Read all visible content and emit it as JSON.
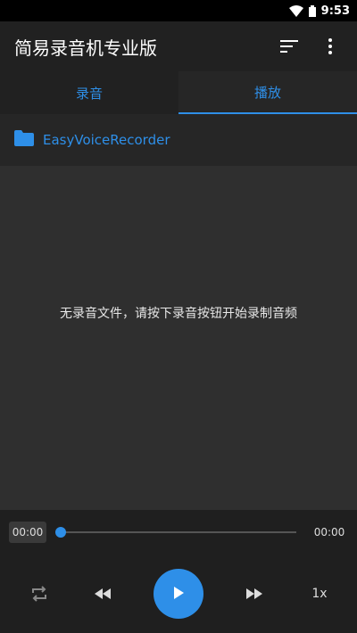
{
  "status": {
    "time": "9:53"
  },
  "app": {
    "title": "简易录音机专业版"
  },
  "tabs": [
    {
      "label": "录音"
    },
    {
      "label": "播放"
    }
  ],
  "folder": {
    "name": "EasyVoiceRecorder"
  },
  "empty_message": "无录音文件，请按下录音按钮开始录制音频",
  "player": {
    "current_time": "00:00",
    "total_time": "00:00",
    "progress": 0,
    "speed": "1x"
  },
  "colors": {
    "accent": "#2e8fe8",
    "background": "#2b2b2b",
    "toolbar": "#212121"
  }
}
